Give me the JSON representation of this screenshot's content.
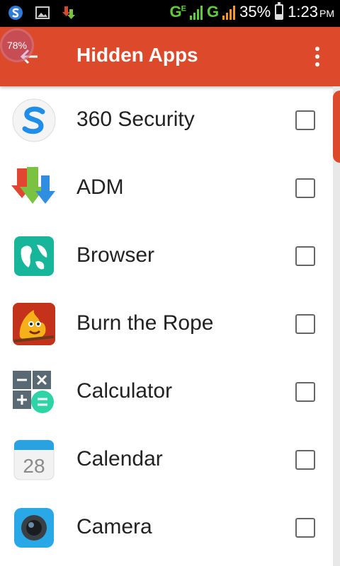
{
  "status_bar": {
    "network_left": "G",
    "network_right": "G",
    "network_sup": "E",
    "battery_percent": "35%",
    "battery_level": 0.35,
    "time": "1:23",
    "ampm": "PM",
    "icons": [
      "s-app-icon",
      "image-icon",
      "download-icon"
    ]
  },
  "toolbar": {
    "title": "Hidden Apps",
    "back_icon": "arrow-left-icon",
    "menu_icon": "more-vert-icon",
    "overlay_badge": "78%"
  },
  "apps": [
    {
      "label": "360 Security",
      "icon": "360-security-icon",
      "checked": false
    },
    {
      "label": "ADM",
      "icon": "adm-icon",
      "checked": false
    },
    {
      "label": "Browser",
      "icon": "browser-icon",
      "checked": false
    },
    {
      "label": "Burn the Rope",
      "icon": "burn-the-rope-icon",
      "checked": false
    },
    {
      "label": "Calculator",
      "icon": "calculator-icon",
      "checked": false
    },
    {
      "label": "Calendar",
      "icon": "calendar-icon",
      "checked": false,
      "icon_text": "28"
    },
    {
      "label": "Camera",
      "icon": "camera-icon",
      "checked": false
    }
  ],
  "colors": {
    "accent": "#dd4a2b",
    "status_bar_bg": "#000000",
    "network_green": "#5ecb3a",
    "signal_orange": "#f39a1e"
  }
}
